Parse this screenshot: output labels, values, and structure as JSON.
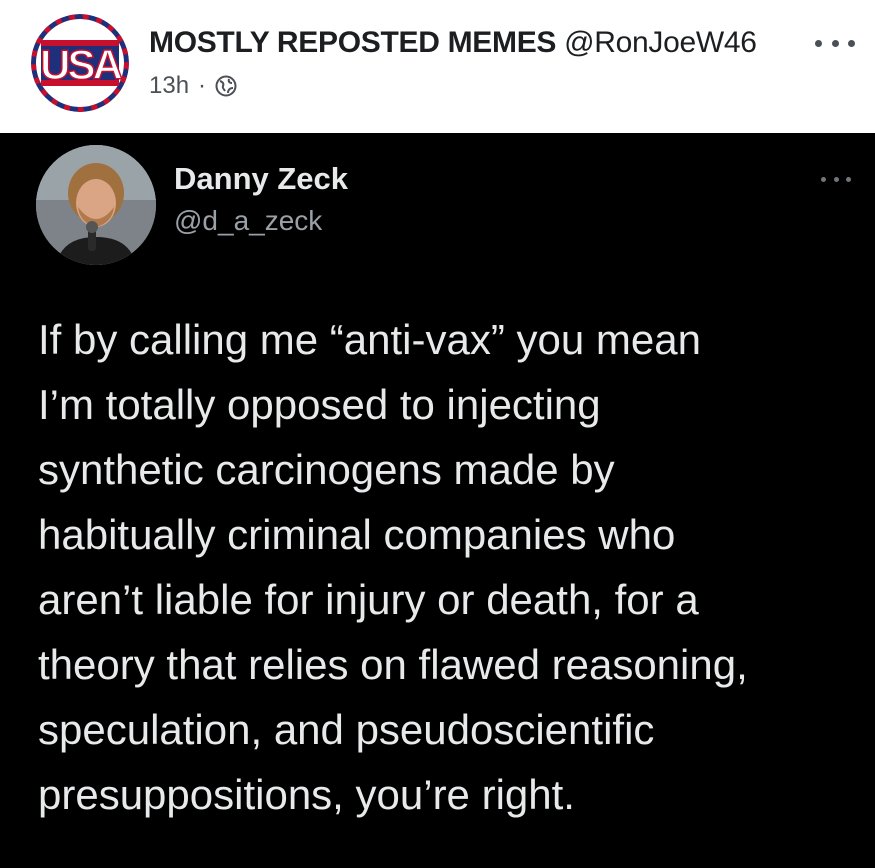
{
  "post": {
    "page_name": "MOSTLY REPOSTED MEMES",
    "page_handle": "@RonJoeW46",
    "time": "13h",
    "separator": "·",
    "avatar": {
      "text": "USA",
      "icon": "usa-flag-logo"
    },
    "privacy_icon": "globe-icon",
    "menu_icon": "more-horizontal-icon"
  },
  "tweet": {
    "author_name": "Danny Zeck",
    "author_handle": "@d_a_zeck",
    "menu_icon": "more-horizontal-icon",
    "text_lines": [
      "If by calling me “anti-vax” you mean",
      "I’m totally opposed to injecting",
      "synthetic carcinogens made by",
      "habitually criminal companies who",
      "aren’t liable for injury or death, for a",
      "theory that relies on flawed reasoning,",
      "speculation, and pseudoscientific",
      "presuppositions, you’re right."
    ]
  },
  "colors": {
    "header_bg": "#ffffff",
    "tweet_bg": "#000000",
    "tweet_text": "#e7e9ea",
    "tweet_secondary": "#9aa0a6",
    "usa_red": "#c8102e",
    "usa_blue": "#1f2f7a"
  }
}
